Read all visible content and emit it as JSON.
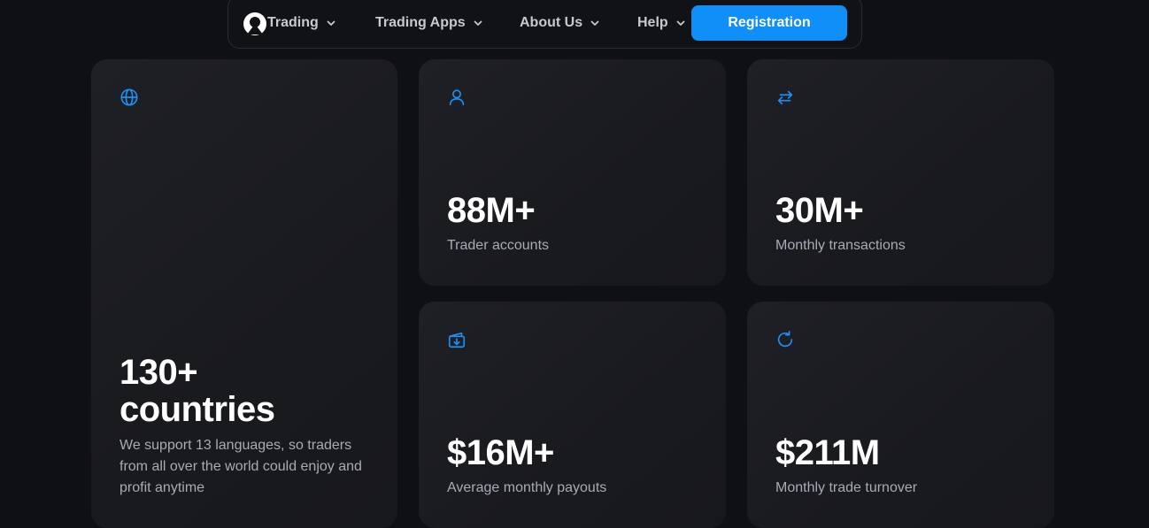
{
  "nav": {
    "items": [
      {
        "label": "Trading"
      },
      {
        "label": "Trading Apps"
      },
      {
        "label": "About Us"
      },
      {
        "label": "Help"
      }
    ],
    "register_label": "Registration"
  },
  "stats": {
    "countries": {
      "value_line1": "130+",
      "value_line2": "countries",
      "description": "We support 13 languages, so traders from all over the world could enjoy and profit anytime",
      "icon": "globe-icon"
    },
    "accounts": {
      "value": "88M+",
      "label": "Trader accounts",
      "icon": "user-icon"
    },
    "transactions": {
      "value": "30M+",
      "label": "Monthly transactions",
      "icon": "transfer-arrows-icon"
    },
    "payouts": {
      "value": "$16M+",
      "label": "Average monthly payouts",
      "icon": "wallet-download-icon"
    },
    "turnover": {
      "value": "$211M",
      "label": "Monthly trade turnover",
      "icon": "refresh-icon"
    }
  },
  "colors": {
    "accent": "#0f8ff7",
    "background": "#0f1013",
    "card": "#1c1d21"
  }
}
